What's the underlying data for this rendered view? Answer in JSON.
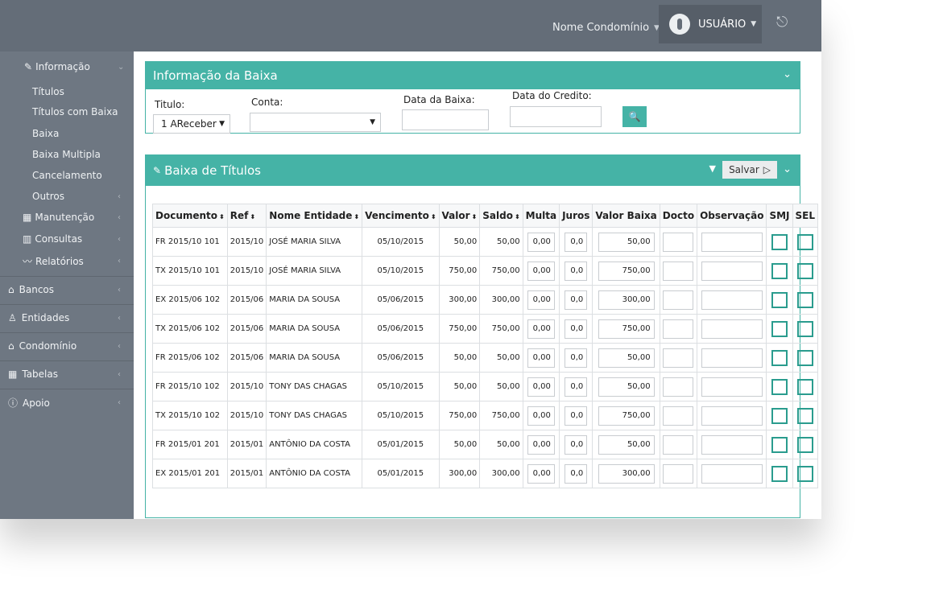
{
  "topbar": {
    "condominio": "Nome Condomínio",
    "user": "USUÁRIO"
  },
  "sidebar": {
    "informacao": {
      "label": "Informação",
      "sub": [
        "Títulos",
        "Títulos com Baixa",
        "Baixa",
        "Baixa Multipla",
        "Cancelamento",
        "Outros"
      ]
    },
    "manutencao": "Manutenção",
    "consultas": "Consultas",
    "relatorios": "Relatórios",
    "bancos": "Bancos",
    "entidades": "Entidades",
    "condominio": "Condomínio",
    "tabelas": "Tabelas",
    "apoio": "Apoio"
  },
  "info_panel": {
    "title": "Informação da Baixa",
    "titulo_label": "Titulo:",
    "titulo_value": "1 AReceber",
    "conta_label": "Conta:",
    "conta_value": "",
    "data_baixa_label": "Data da Baixa:",
    "data_credito_label": "Data do Credito:"
  },
  "baixa_panel": {
    "title": "Baixa de Títulos",
    "salvar_label": "Salvar",
    "columns": [
      "Documento",
      "Ref",
      "Nome Entidade",
      "Vencimento",
      "Valor",
      "Saldo",
      "Multa",
      "Juros",
      "Valor Baixa",
      "Docto",
      "Observação",
      "SMJ",
      "SEL"
    ],
    "rows": [
      {
        "documento": "FR 2015/10 101",
        "ref": "2015/10",
        "nome": "JOSÉ MARIA SILVA",
        "vencimento": "05/10/2015",
        "valor": "50,00",
        "saldo": "50,00",
        "multa": "0,00",
        "juros": "0,0",
        "valor_baixa": "50,00"
      },
      {
        "documento": "TX 2015/10 101",
        "ref": "2015/10",
        "nome": "JOSÉ MARIA SILVA",
        "vencimento": "05/10/2015",
        "valor": "750,00",
        "saldo": "750,00",
        "multa": "0,00",
        "juros": "0,0",
        "valor_baixa": "750,00"
      },
      {
        "documento": "EX 2015/06 102",
        "ref": "2015/06",
        "nome": "MARIA DA SOUSA",
        "vencimento": "05/06/2015",
        "valor": "300,00",
        "saldo": "300,00",
        "multa": "0,00",
        "juros": "0,0",
        "valor_baixa": "300,00"
      },
      {
        "documento": "TX 2015/06 102",
        "ref": "2015/06",
        "nome": "MARIA DA SOUSA",
        "vencimento": "05/06/2015",
        "valor": "750,00",
        "saldo": "750,00",
        "multa": "0,00",
        "juros": "0,0",
        "valor_baixa": "750,00"
      },
      {
        "documento": "FR 2015/06 102",
        "ref": "2015/06",
        "nome": "MARIA DA SOUSA",
        "vencimento": "05/06/2015",
        "valor": "50,00",
        "saldo": "50,00",
        "multa": "0,00",
        "juros": "0,0",
        "valor_baixa": "50,00"
      },
      {
        "documento": "FR 2015/10 102",
        "ref": "2015/10",
        "nome": "TONY DAS CHAGAS",
        "vencimento": "05/10/2015",
        "valor": "50,00",
        "saldo": "50,00",
        "multa": "0,00",
        "juros": "0,0",
        "valor_baixa": "50,00"
      },
      {
        "documento": "TX 2015/10 102",
        "ref": "2015/10",
        "nome": "TONY DAS CHAGAS",
        "vencimento": "05/10/2015",
        "valor": "750,00",
        "saldo": "750,00",
        "multa": "0,00",
        "juros": "0,0",
        "valor_baixa": "750,00"
      },
      {
        "documento": "FR 2015/01 201",
        "ref": "2015/01",
        "nome": "ANTÔNIO DA COSTA",
        "vencimento": "05/01/2015",
        "valor": "50,00",
        "saldo": "50,00",
        "multa": "0,00",
        "juros": "0,0",
        "valor_baixa": "50,00"
      },
      {
        "documento": "EX 2015/01 201",
        "ref": "2015/01",
        "nome": "ANTÔNIO DA COSTA",
        "vencimento": "05/01/2015",
        "valor": "300,00",
        "saldo": "300,00",
        "multa": "0,00",
        "juros": "0,0",
        "valor_baixa": "300,00"
      }
    ]
  },
  "colors": {
    "accent": "#45b3a6",
    "topbar": "#646d78",
    "sidebar": "#6e7782"
  }
}
